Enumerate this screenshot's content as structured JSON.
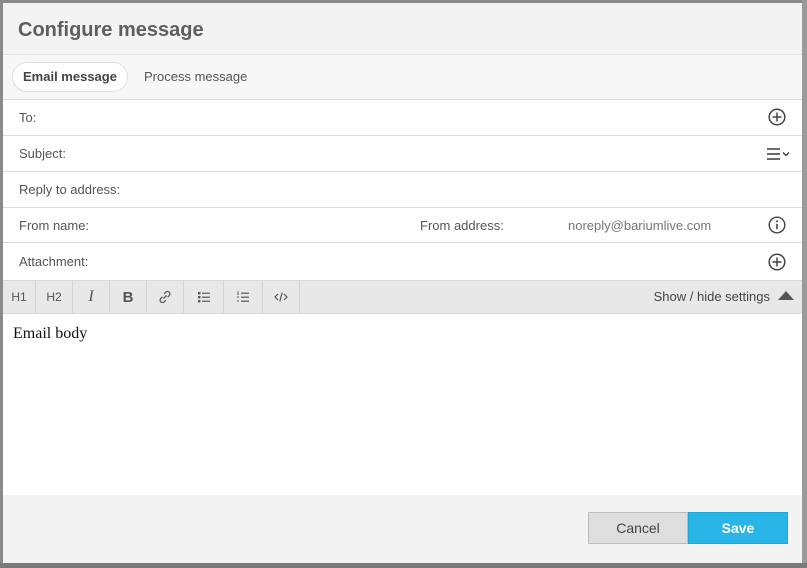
{
  "dialog": {
    "title": "Configure message",
    "tabs": [
      {
        "label": "Email message",
        "active": true
      },
      {
        "label": "Process message",
        "active": false
      }
    ]
  },
  "fields": {
    "to": {
      "label": "To:",
      "icon": "add-circle-icon"
    },
    "subject": {
      "label": "Subject:",
      "icon": "list-dropdown-icon"
    },
    "reply_to": {
      "label": "Reply to address:"
    },
    "from_name": {
      "label": "From name:"
    },
    "from_address": {
      "label": "From address:",
      "placeholder": "noreply@bariumlive.com",
      "icon": "info-circle-icon"
    },
    "attachment": {
      "label": "Attachment:",
      "icon": "add-circle-icon"
    }
  },
  "toolbar": {
    "h1": "H1",
    "h2": "H2",
    "italic": "I",
    "bold": "B",
    "settings_label": "Show / hide settings"
  },
  "editor": {
    "body": "Email body"
  },
  "footer": {
    "cancel_label": "Cancel",
    "save_label": "Save"
  },
  "colors": {
    "accent": "#29b5e8",
    "header_bg": "#f3f3f3"
  }
}
